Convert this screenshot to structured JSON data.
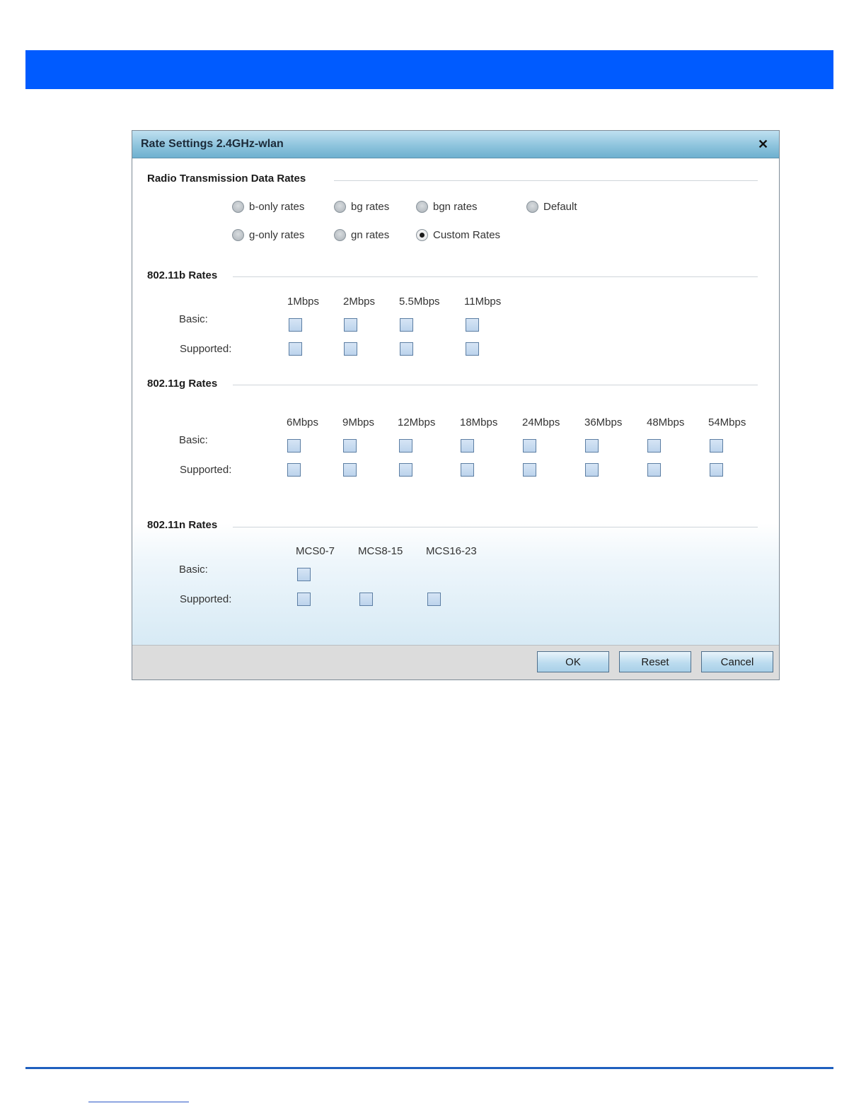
{
  "dialog": {
    "title": "Rate Settings 2.4GHz-wlan"
  },
  "radio_section": {
    "title": "Radio Transmission Data Rates",
    "options": [
      {
        "label": "b-only rates",
        "checked": false
      },
      {
        "label": "bg rates",
        "checked": false
      },
      {
        "label": "bgn rates",
        "checked": false
      },
      {
        "label": "Default",
        "checked": false
      },
      {
        "label": "g-only rates",
        "checked": false
      },
      {
        "label": "gn rates",
        "checked": false
      },
      {
        "label": "Custom Rates",
        "checked": true
      }
    ]
  },
  "b_rates": {
    "title": "802.11b Rates",
    "basic_label": "Basic:",
    "supported_label": "Supported:",
    "columns": [
      "1Mbps",
      "2Mbps",
      "5.5Mbps",
      "11Mbps"
    ]
  },
  "g_rates": {
    "title": "802.11g Rates",
    "basic_label": "Basic:",
    "supported_label": "Supported:",
    "columns": [
      "6Mbps",
      "9Mbps",
      "12Mbps",
      "18Mbps",
      "24Mbps",
      "36Mbps",
      "48Mbps",
      "54Mbps"
    ]
  },
  "n_rates": {
    "title": "802.11n Rates",
    "basic_label": "Basic:",
    "supported_label": "Supported:",
    "columns": [
      "MCS0-7",
      "MCS8-15",
      "MCS16-23"
    ]
  },
  "buttons": {
    "ok": "OK",
    "reset": "Reset",
    "cancel": "Cancel"
  },
  "colors": {
    "banner": "#005bff",
    "titlebar": "#8ec4dd",
    "checkbox_fill": "#c7daf0"
  }
}
